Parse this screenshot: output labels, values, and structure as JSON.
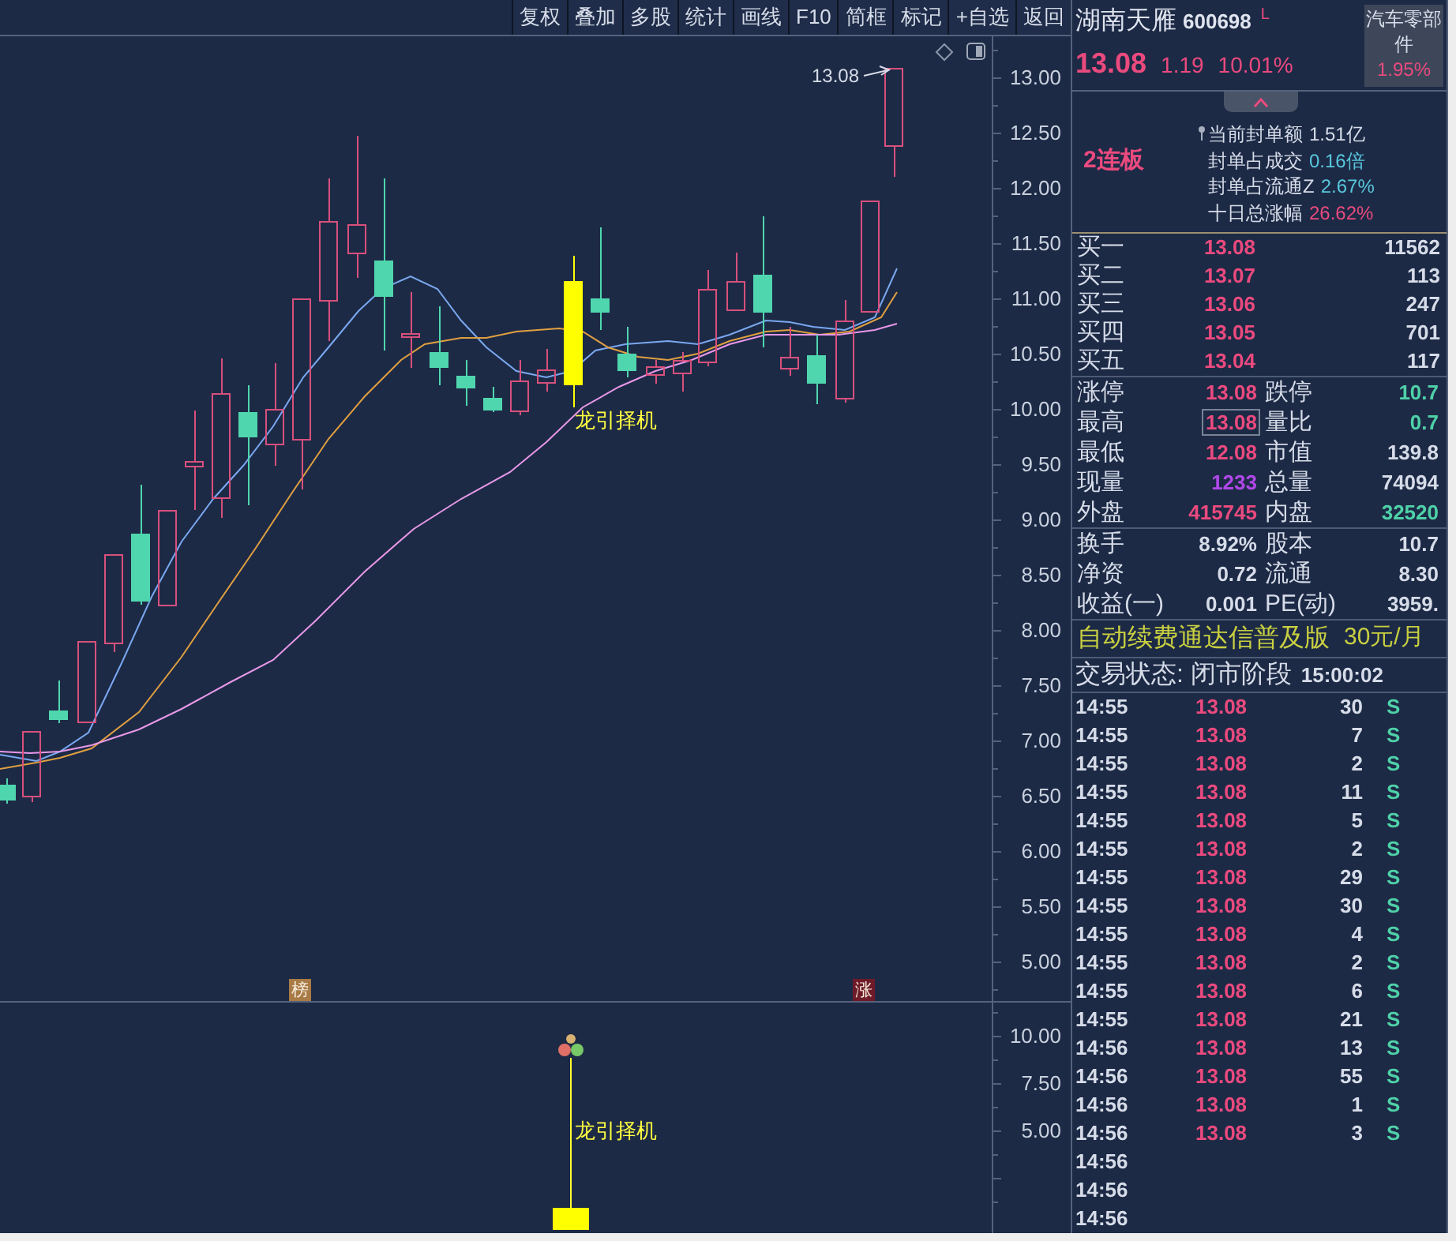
{
  "toolbar": [
    "复权",
    "叠加",
    "多股",
    "统计",
    "画线",
    "F10",
    "简框",
    "标记",
    "+自选",
    "返回"
  ],
  "chart": {
    "price_marker": "13.08",
    "signal_label": "龙引择机",
    "y_axis": [
      "13.00",
      "12.50",
      "12.00",
      "11.50",
      "11.00",
      "10.50",
      "10.00",
      "9.50",
      "9.00",
      "8.50",
      "8.00",
      "7.50",
      "7.00",
      "6.50",
      "6.00",
      "5.50",
      "5.00"
    ],
    "tags": [
      {
        "kind": "rank",
        "label": "榜"
      },
      {
        "kind": "limit_up",
        "label": "涨"
      }
    ]
  },
  "indicator": {
    "signal_label": "龙引择机",
    "y_axis": [
      "10.00",
      "7.50",
      "5.00"
    ]
  },
  "quote": {
    "name": "湖南天雁",
    "code": "600698",
    "flag": "L",
    "price": "13.08",
    "change": "1.19",
    "change_percent": "10.01%",
    "sector": {
      "name": "汽车零部件",
      "change": "1.95%"
    }
  },
  "limit_info": {
    "streak": "2连板",
    "items": [
      {
        "label": "当前封单额",
        "value": "1.51亿",
        "color": "#d6dce8",
        "pinned": true
      },
      {
        "label": "封单占成交",
        "value": "0.16倍",
        "color": "#58c8dc",
        "pinned": false
      },
      {
        "label": "封单占流通Z",
        "value": "2.67%",
        "color": "#58c8dc",
        "pinned": false
      },
      {
        "label": "十日总涨幅",
        "value": "26.62%",
        "color": "#ea4a7e",
        "pinned": false
      }
    ]
  },
  "order_book": [
    {
      "label": "买一",
      "price": "13.08",
      "volume": "11562"
    },
    {
      "label": "买二",
      "price": "13.07",
      "volume": "113"
    },
    {
      "label": "买三",
      "price": "13.06",
      "volume": "247"
    },
    {
      "label": "买四",
      "price": "13.05",
      "volume": "701"
    },
    {
      "label": "买五",
      "price": "13.04",
      "volume": "117"
    }
  ],
  "stats": [
    {
      "cells": [
        {
          "label": "涨停",
          "value": "13.08",
          "color": "#ea4a7e",
          "boxed": false
        },
        {
          "label": "跌停",
          "value": "10.7",
          "color": "#4fd1a8",
          "boxed": false
        }
      ]
    },
    {
      "cells": [
        {
          "label": "最高",
          "value": "13.08",
          "color": "#ea4a7e",
          "boxed": true
        },
        {
          "label": "量比",
          "value": "0.7",
          "color": "#4fd1a8",
          "boxed": false
        }
      ]
    },
    {
      "cells": [
        {
          "label": "最低",
          "value": "12.08",
          "color": "#ea4a7e",
          "boxed": false
        },
        {
          "label": "市值",
          "value": "139.8",
          "color": "#d6dce8",
          "boxed": false
        }
      ]
    },
    {
      "cells": [
        {
          "label": "现量",
          "value": "1233",
          "color": "#b048e8",
          "boxed": false
        },
        {
          "label": "总量",
          "value": "74094",
          "color": "#d6dce8",
          "boxed": false
        }
      ]
    },
    {
      "cells": [
        {
          "label": "外盘",
          "value": "415745",
          "color": "#ea4a7e",
          "boxed": false
        },
        {
          "label": "内盘",
          "value": "32520",
          "color": "#4fd1a8",
          "boxed": false
        }
      ]
    }
  ],
  "fundamentals": [
    {
      "cells": [
        {
          "label": "换手",
          "value": "8.92%",
          "color": "#d6dce8",
          "boxed": false
        },
        {
          "label": "股本",
          "value": "10.7",
          "color": "#d6dce8",
          "boxed": false
        }
      ]
    },
    {
      "cells": [
        {
          "label": "净资",
          "value": "0.72",
          "color": "#d6dce8",
          "boxed": false
        },
        {
          "label": "流通",
          "value": "8.30",
          "color": "#d6dce8",
          "boxed": false
        }
      ]
    },
    {
      "cells": [
        {
          "label": "收益(一)",
          "value": "0.001",
          "color": "#d6dce8",
          "boxed": false
        },
        {
          "label": "PE(动)",
          "value": "3959.",
          "color": "#d6dce8",
          "boxed": false
        }
      ]
    }
  ],
  "promo": {
    "text": "自动续费通达信普及版",
    "price": "30元/月"
  },
  "trade_status": {
    "text": "交易状态: 闭市阶段",
    "time": "15:00:02"
  },
  "ticks": [
    {
      "time": "14:55",
      "price": "13.08",
      "volume": "30",
      "side": "S"
    },
    {
      "time": "14:55",
      "price": "13.08",
      "volume": "7",
      "side": "S"
    },
    {
      "time": "14:55",
      "price": "13.08",
      "volume": "2",
      "side": "S"
    },
    {
      "time": "14:55",
      "price": "13.08",
      "volume": "11",
      "side": "S"
    },
    {
      "time": "14:55",
      "price": "13.08",
      "volume": "5",
      "side": "S"
    },
    {
      "time": "14:55",
      "price": "13.08",
      "volume": "2",
      "side": "S"
    },
    {
      "time": "14:55",
      "price": "13.08",
      "volume": "29",
      "side": "S"
    },
    {
      "time": "14:55",
      "price": "13.08",
      "volume": "30",
      "side": "S"
    },
    {
      "time": "14:55",
      "price": "13.08",
      "volume": "4",
      "side": "S"
    },
    {
      "time": "14:55",
      "price": "13.08",
      "volume": "2",
      "side": "S"
    },
    {
      "time": "14:55",
      "price": "13.08",
      "volume": "6",
      "side": "S"
    },
    {
      "time": "14:55",
      "price": "13.08",
      "volume": "21",
      "side": "S"
    },
    {
      "time": "14:56",
      "price": "13.08",
      "volume": "13",
      "side": "S"
    },
    {
      "time": "14:56",
      "price": "13.08",
      "volume": "55",
      "side": "S"
    },
    {
      "time": "14:56",
      "price": "13.08",
      "volume": "1",
      "side": "S"
    },
    {
      "time": "14:56",
      "price": "13.08",
      "volume": "3",
      "side": "S"
    },
    {
      "time": "14:56"
    },
    {
      "time": "14:56"
    },
    {
      "time": "14:56"
    }
  ]
}
